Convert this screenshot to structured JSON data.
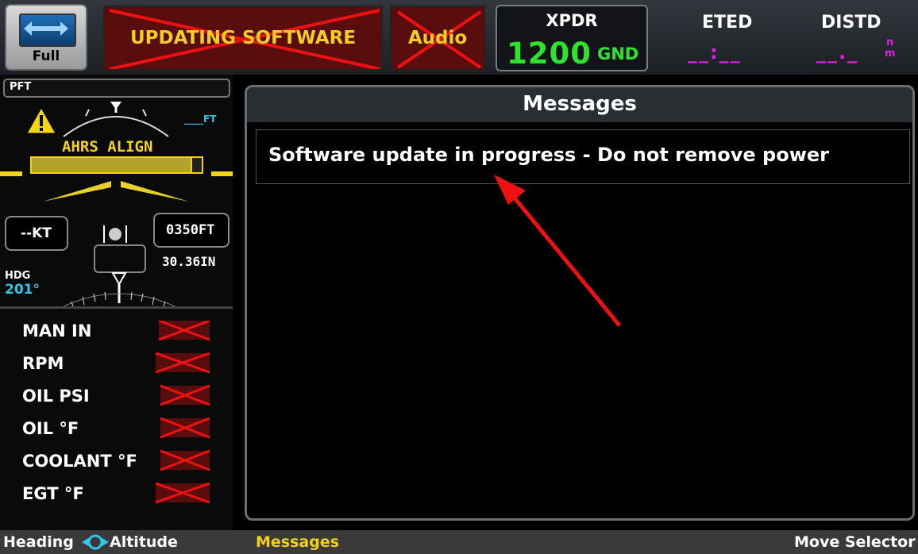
{
  "topbar": {
    "full_button_label": "Full",
    "annunciator_main": "UPDATING SOFTWARE",
    "annunciator_audio": "Audio",
    "xpdr": {
      "title": "XPDR",
      "code": "1200",
      "mode": "GND"
    },
    "eted": {
      "label": "ETED",
      "value": "__:__"
    },
    "distd": {
      "label": "DISTD",
      "value": "__._",
      "unit_top": "n",
      "unit_bottom": "m"
    }
  },
  "left": {
    "pft_label": "PFT",
    "ahrs_align": "AHRS ALIGN",
    "alt_dash": "____FT",
    "speed": "--KT",
    "altitude": "0350FT",
    "baro": "30.36IN",
    "hdg_label": "HDG",
    "hdg_value": "201°",
    "engine": [
      "MAN IN",
      "RPM",
      "OIL PSI",
      "OIL °F",
      "COOLANT °F",
      "EGT °F"
    ]
  },
  "messages": {
    "title": "Messages",
    "items": [
      "Software update in progress - Do not remove power"
    ]
  },
  "bottombar": {
    "heading": "Heading",
    "altitude": "Altitude",
    "messages": "Messages",
    "move_selector": "Move Selector"
  },
  "colors": {
    "annunciator_text": "#f2cf1e",
    "annunciator_bg": "#5a0d0d",
    "xpdr_green": "#2fe22f",
    "magenta": "#e21ee2",
    "cyan": "#2fc8e8",
    "warning_yellow": "#f5d315",
    "arrow_red": "#e11"
  },
  "icons": [
    "full-screen-icon",
    "warning-triangle-icon",
    "sync-icon",
    "attitude-indicator-icon"
  ]
}
